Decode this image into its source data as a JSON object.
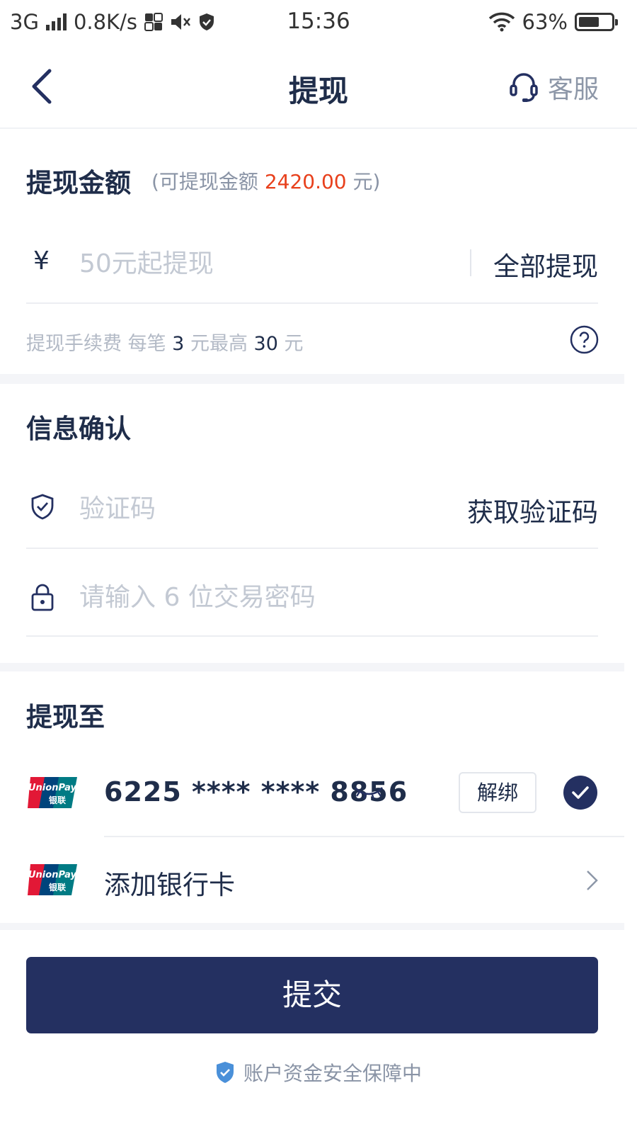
{
  "status_bar": {
    "network": "3G",
    "speed": "0.8K/s",
    "time": "15:36",
    "battery": "63%",
    "battery_level": 0.63
  },
  "nav": {
    "title": "提现",
    "service_label": "客服"
  },
  "amount_section": {
    "title": "提现金额",
    "available_prefix": "(可提现金额 ",
    "available_amount": "2420.00",
    "available_suffix": " 元)",
    "currency_symbol": "¥",
    "amount_placeholder": "50元起提现",
    "withdraw_all_label": "全部提现",
    "fee_label": "提现手续费  每笔 ",
    "fee_per": "3",
    "fee_mid": " 元最高 ",
    "fee_max": "30",
    "fee_suffix": " 元"
  },
  "confirm_section": {
    "title": "信息确认",
    "code_placeholder": "验证码",
    "get_code_label": "获取验证码",
    "password_placeholder": "请输入 6 位交易密码"
  },
  "target_section": {
    "title": "提现至",
    "card_number": "6225 **** **** 8856",
    "unbind_label": "解绑",
    "add_card_label": "添加银行卡",
    "card_logo_text_top": "UnionPay",
    "card_logo_text_bottom": "银联"
  },
  "submit_label": "提交",
  "safety_note": "账户资金安全保障中",
  "colors": {
    "primary": "#243061",
    "accent": "#e8401c",
    "shield": "#4a90d9"
  }
}
